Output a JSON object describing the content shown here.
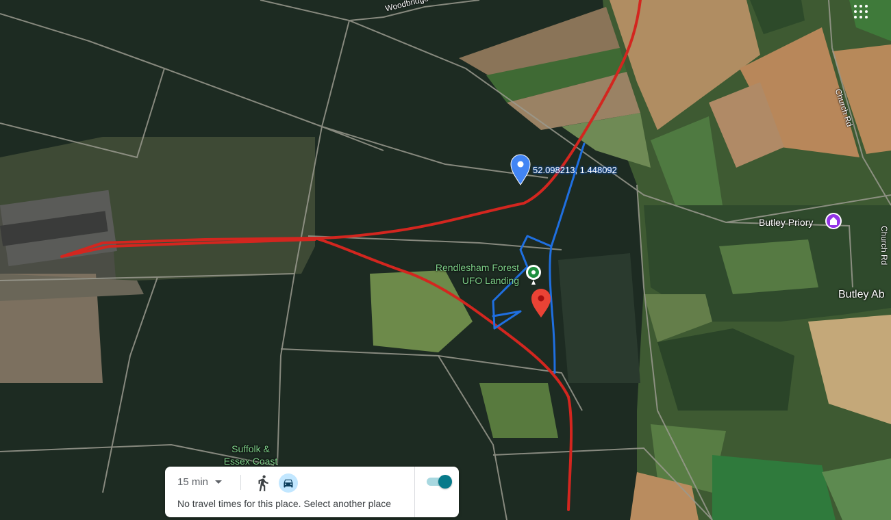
{
  "map": {
    "road_labels": {
      "woodbridge": "Woodbridge R",
      "church_rd_north": "Church Rd",
      "church_rd_south": "Church Rd"
    },
    "places": {
      "butley_priory": "Butley Priory",
      "butley_abbey": "Butley Ab",
      "suffolk_line1": "Suffolk &",
      "suffolk_line2": "Essex Coast"
    },
    "poi": {
      "line1": "Rendlesham Forest",
      "line2": "UFO Landing"
    },
    "dropped_pin": {
      "coordinates": "52.098213, 1.448092"
    }
  },
  "travel_panel": {
    "duration": "15 min",
    "message": "No travel times for this place. Select another place",
    "toggle_on": true
  },
  "icons": {
    "apps": "apps-grid-icon",
    "walk": "walk-icon",
    "drive": "car-icon",
    "priory": "place-of-worship-icon"
  },
  "colors": {
    "red_annotation": "#d3261f",
    "blue_annotation": "#1f6fe0",
    "pin_blue": "#4285f4",
    "pin_red": "#ea4335",
    "toggle": "#077a8a"
  }
}
